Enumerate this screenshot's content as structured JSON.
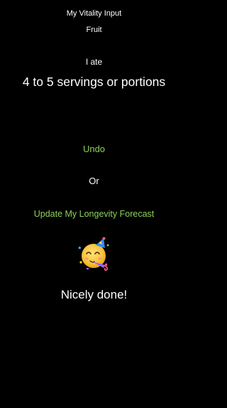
{
  "header": {
    "title": "My Vitality Input",
    "category": "Fruit"
  },
  "entry": {
    "prefix": "I ate",
    "value": "4 to 5 servings or portions"
  },
  "actions": {
    "undo_label": "Undo",
    "separator": "Or",
    "update_label": "Update My Longevity Forecast"
  },
  "feedback": {
    "icon": "partying-face-icon",
    "message": "Nicely done!"
  },
  "colors": {
    "background": "#000000",
    "text": "#ffffff",
    "accent": "#8fcf5a"
  }
}
